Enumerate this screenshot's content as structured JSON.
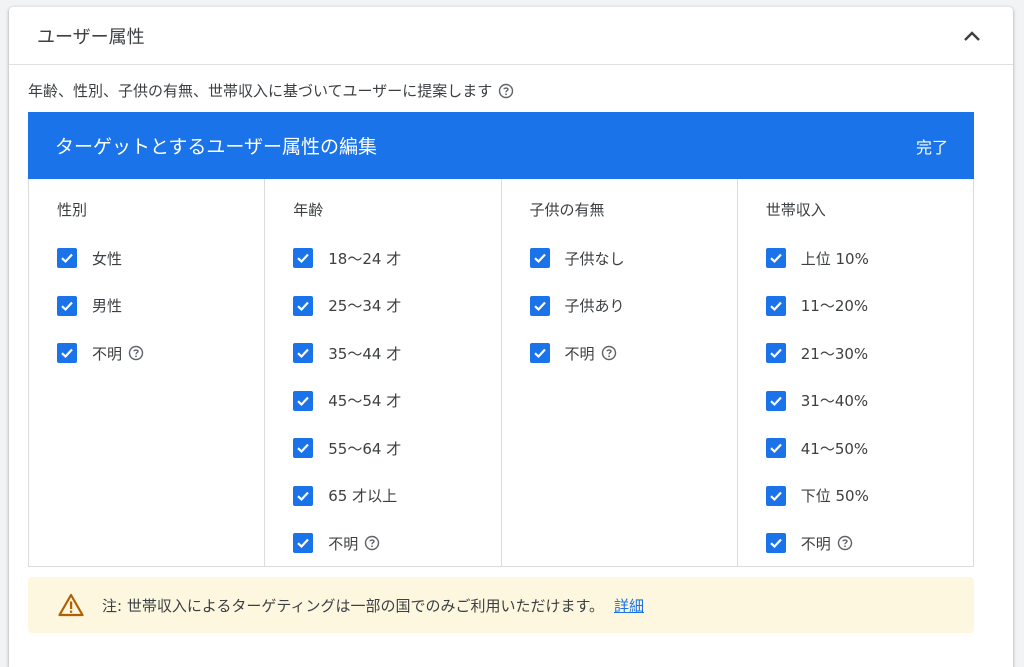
{
  "section": {
    "title": "ユーザー属性",
    "description": "年齢、性別、子供の有無、世帯収入に基づいてユーザーに提案します"
  },
  "editor": {
    "title": "ターゲットとするユーザー属性の編集",
    "done_label": "完了"
  },
  "columns": {
    "gender": {
      "title": "性別",
      "options": [
        {
          "label": "女性",
          "checked": true
        },
        {
          "label": "男性",
          "checked": true
        },
        {
          "label": "不明",
          "checked": true
        }
      ]
    },
    "age": {
      "title": "年齢",
      "options": [
        {
          "label": "18～24 才",
          "checked": true
        },
        {
          "label": "25～34 才",
          "checked": true
        },
        {
          "label": "35～44 才",
          "checked": true
        },
        {
          "label": "45～54 才",
          "checked": true
        },
        {
          "label": "55～64 才",
          "checked": true
        },
        {
          "label": "65 才以上",
          "checked": true
        },
        {
          "label": "不明",
          "checked": true
        }
      ]
    },
    "parental": {
      "title": "子供の有無",
      "options": [
        {
          "label": "子供なし",
          "checked": true
        },
        {
          "label": "子供あり",
          "checked": true
        },
        {
          "label": "不明",
          "checked": true
        }
      ]
    },
    "income": {
      "title": "世帯収入",
      "options": [
        {
          "label": "上位 10%",
          "checked": true
        },
        {
          "label": "11～20%",
          "checked": true
        },
        {
          "label": "21～30%",
          "checked": true
        },
        {
          "label": "31～40%",
          "checked": true
        },
        {
          "label": "41～50%",
          "checked": true
        },
        {
          "label": "下位 50%",
          "checked": true
        },
        {
          "label": "不明",
          "checked": true
        }
      ]
    }
  },
  "notice": {
    "text": "注: 世帯収入によるターゲティングは一部の国でのみご利用いただけます。",
    "link_label": "詳細"
  },
  "colors": {
    "accent": "#1a73e8",
    "notice_bg": "#fef7e0",
    "warning": "#b06000"
  }
}
